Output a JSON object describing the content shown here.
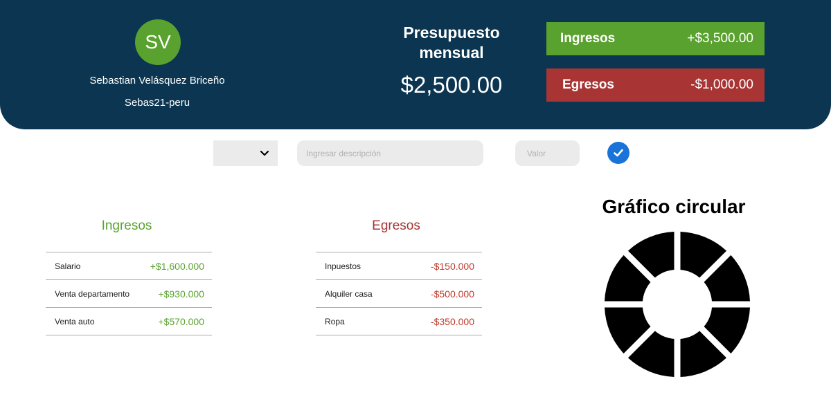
{
  "profile": {
    "initials": "SV",
    "name": "Sebastian Velásquez Briceño",
    "handle": "Sebas21-peru"
  },
  "budget": {
    "title": "Presupuesto mensual",
    "amount": "$2,500.00"
  },
  "summary": {
    "income_label": "Ingresos",
    "income_value": "+$3,500.00",
    "expense_label": "Egresos",
    "expense_value": "-$1,000.00"
  },
  "form": {
    "select_value": "",
    "description_placeholder": "Ingresar descripción",
    "value_placeholder": "Valor"
  },
  "income": {
    "title": "Ingresos",
    "rows": [
      {
        "desc": "Salario",
        "amount": "+$1,600.000"
      },
      {
        "desc": "Venta departamento",
        "amount": "+$930.000"
      },
      {
        "desc": "Venta auto",
        "amount": "+$570.000"
      }
    ]
  },
  "expenses": {
    "title": "Egresos",
    "rows": [
      {
        "desc": "Inpuestos",
        "amount": "-$150.000"
      },
      {
        "desc": "Alquiler casa",
        "amount": "-$500.000"
      },
      {
        "desc": "Ropa",
        "amount": "-$350.000"
      }
    ]
  },
  "chart": {
    "title": "Gráfico circular",
    "segments": 8,
    "color": "#000000"
  },
  "colors": {
    "header_bg": "#0b3550",
    "income": "#5aa22f",
    "expense": "#a83434",
    "confirm": "#1a73d9"
  },
  "icons": {
    "chevron": "chevron-down-icon",
    "confirm": "check-circle-icon"
  }
}
